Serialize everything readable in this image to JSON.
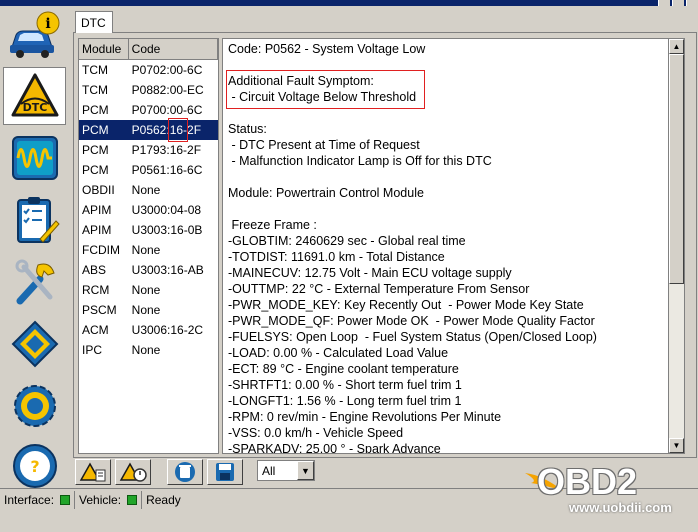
{
  "tab": {
    "label": "DTC"
  },
  "dtc_list": {
    "columns": {
      "module": "Module",
      "code": "Code"
    },
    "rows": [
      {
        "module": "TCM",
        "code": "P0702:00-6C"
      },
      {
        "module": "TCM",
        "code": "P0882:00-EC"
      },
      {
        "module": "PCM",
        "code": "P0700:00-6C"
      },
      {
        "module": "PCM",
        "code": "P0562:16-2F",
        "selected": true
      },
      {
        "module": "PCM",
        "code": "P1793:16-2F"
      },
      {
        "module": "PCM",
        "code": "P0561:16-6C"
      },
      {
        "module": "OBDII",
        "code": "None"
      },
      {
        "module": "APIM",
        "code": "U3000:04-08"
      },
      {
        "module": "APIM",
        "code": "U3003:16-0B"
      },
      {
        "module": "FCDIM",
        "code": "None"
      },
      {
        "module": "ABS",
        "code": "U3003:16-AB"
      },
      {
        "module": "RCM",
        "code": "None"
      },
      {
        "module": "PSCM",
        "code": "None"
      },
      {
        "module": "ACM",
        "code": "U3006:16-2C"
      },
      {
        "module": "IPC",
        "code": "None"
      }
    ]
  },
  "detail": {
    "lines": [
      "Code: P0562 - System Voltage Low",
      "",
      "Additional Fault Symptom:",
      " - Circuit Voltage Below Threshold",
      "",
      "Status:",
      " - DTC Present at Time of Request",
      " - Malfunction Indicator Lamp is Off for this DTC",
      "",
      "Module: Powertrain Control Module",
      "",
      " Freeze Frame :",
      "-GLOBTIM: 2460629 sec - Global real time",
      "-TOTDIST: 11691.0 km - Total Distance",
      "-MAINECUV: 12.75 Volt - Main ECU voltage supply",
      "-OUTTMP: 22 °C - External Temperature From Sensor",
      "-PWR_MODE_KEY: Key Recently Out  - Power Mode Key State",
      "-PWR_MODE_QF: Power Mode OK  - Power Mode Quality Factor",
      "-FUELSYS: Open Loop  - Fuel System Status (Open/Closed Loop)",
      "-LOAD: 0.00 % - Calculated Load Value",
      "-ECT: 89 °C - Engine coolant temperature",
      "-SHRTFT1: 0.00 % - Short term fuel trim 1",
      "-LONGFT1: 1.56 % - Long term fuel trim 1",
      "-RPM: 0 rev/min - Engine Revolutions Per Minute",
      "-VSS: 0.0 km/h - Vehicle Speed",
      "-SPARKADV: 25.00 ° - Spark Advance"
    ]
  },
  "filter": {
    "value": "All"
  },
  "status": {
    "interface_label": "Interface:",
    "vehicle_label": "Vehicle:",
    "state": "Ready"
  },
  "watermark": {
    "logo": "OBD2",
    "url": "www.uobdii.com"
  },
  "colors": {
    "selection": "#0a246a",
    "marker": "#e02020",
    "led": "#21a52a",
    "dtc_icon": "#f5b800"
  },
  "icons": {
    "left_toolbar": [
      "vehicle-info-icon",
      "dtc-icon",
      "oscilloscope-icon",
      "checklist-icon",
      "tools-icon",
      "module-chip-icon",
      "settings-gear-icon",
      "help-wheel-icon"
    ],
    "bottom_toolbar": [
      "dtc-report-icon",
      "dtc-freeze-icon",
      "clear-dtc-icon",
      "save-icon"
    ]
  }
}
